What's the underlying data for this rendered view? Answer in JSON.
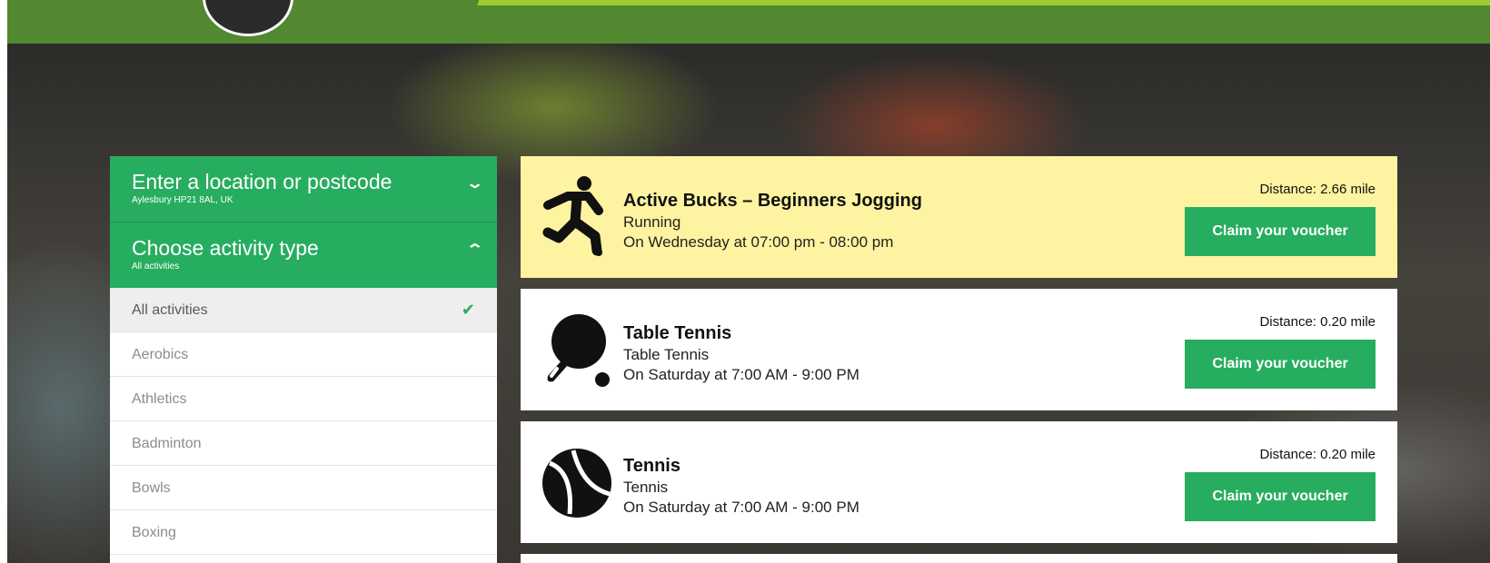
{
  "filters": {
    "location": {
      "title": "Enter a location or postcode",
      "value": "Aylesbury HP21 8AL, UK",
      "chevron": "chevron-down-icon"
    },
    "activity": {
      "title": "Choose activity type",
      "value": "All activities",
      "chevron": "chevron-up-icon"
    },
    "options": [
      "All activities",
      "Aerobics",
      "Athletics",
      "Badminton",
      "Bowls",
      "Boxing"
    ],
    "selected_index": 0
  },
  "activities": [
    {
      "name": "Active Bucks – Beginners Jogging",
      "type": "Running",
      "schedule": "On Wednesday at 07:00 pm - 08:00 pm",
      "distance": "Distance: 2.66 mile",
      "button": "Claim your voucher",
      "icon": "running-person-icon",
      "highlighted": true
    },
    {
      "name": "Table Tennis",
      "type": "Table Tennis",
      "schedule": "On Saturday at 7:00 AM - 9:00 PM",
      "distance": "Distance: 0.20 mile",
      "button": "Claim your voucher",
      "icon": "table-tennis-paddle-icon",
      "highlighted": false
    },
    {
      "name": "Tennis",
      "type": "Tennis",
      "schedule": "On Saturday at 7:00 AM - 9:00 PM",
      "distance": "Distance: 0.20 mile",
      "button": "Claim your voucher",
      "icon": "tennis-ball-icon",
      "highlighted": false
    }
  ],
  "colors": {
    "brand_green": "#27ad60",
    "header_green": "#52882f",
    "highlight_yellow": "#fdf3a0"
  }
}
